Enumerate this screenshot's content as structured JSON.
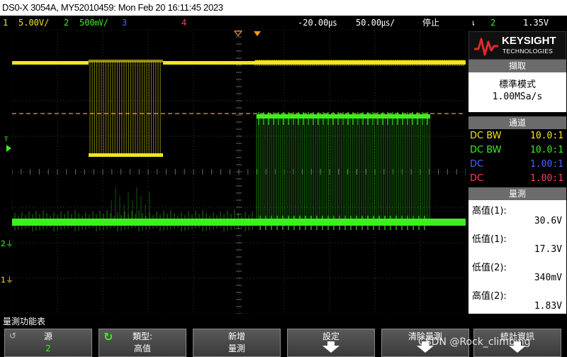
{
  "title_bar": "DS0-X 3054A, MY52010459: Mon Feb 20 16:11:45 2023",
  "status": {
    "ch1_num": "1",
    "ch1_scale": "5.00V/",
    "ch2_num": "2",
    "ch2_scale": "500㎷/",
    "ch3_num": "3",
    "ch4_num": "4",
    "timebase_delay": "-20.00㎲",
    "timebase_scale": "50.00㎲/",
    "run_state": "停止",
    "trigger_source": "2",
    "trigger_level": "1.35V"
  },
  "brand": {
    "name": "KEYSIGHT",
    "sub": "TECHNOLOGIES"
  },
  "acquisition": {
    "header": "擷取",
    "mode": "標準模式",
    "rate": "1.00MSa/s"
  },
  "channels": {
    "header": "通道",
    "rows": [
      {
        "coupling": "DC BW",
        "probe": "10.0:1",
        "color": "#f2e51e"
      },
      {
        "coupling": "DC BW",
        "probe": "10.0:1",
        "color": "#3cf020"
      },
      {
        "coupling": "DC",
        "probe": "1.00:1",
        "color": "#4b63ff"
      },
      {
        "coupling": "DC",
        "probe": "1.00:1",
        "color": "#ff3a6a"
      }
    ]
  },
  "measurements": {
    "header": "量測",
    "items": [
      {
        "label": "高值(1):",
        "value": "30.6V"
      },
      {
        "label": "低值(1):",
        "value": "17.3V"
      },
      {
        "label": "低值(2):",
        "value": "340mV"
      },
      {
        "label": "高值(2):",
        "value": "1.83V"
      }
    ]
  },
  "channel_markers": {
    "trig_marker": "T",
    "ch2": "2",
    "ch1": "1"
  },
  "menu_title": "量測功能表",
  "softkeys": [
    {
      "l1": "源",
      "l2": "2"
    },
    {
      "l1": "類型:",
      "l2": "高值"
    },
    {
      "l1": "新增",
      "l2": "量測"
    },
    {
      "l1": "設定",
      "l2": ""
    },
    {
      "l1": "清除量測",
      "l2": ""
    },
    {
      "l1": "統計資訊",
      "l2": ""
    }
  ],
  "watermark": "CSDN @Rock_climbing",
  "colors": {
    "ch1": "#f2e51e",
    "ch2": "#3cf020",
    "ch3": "#4b63ff",
    "ch4": "#ff3a6a",
    "trigger_line": "#f39a2a"
  }
}
